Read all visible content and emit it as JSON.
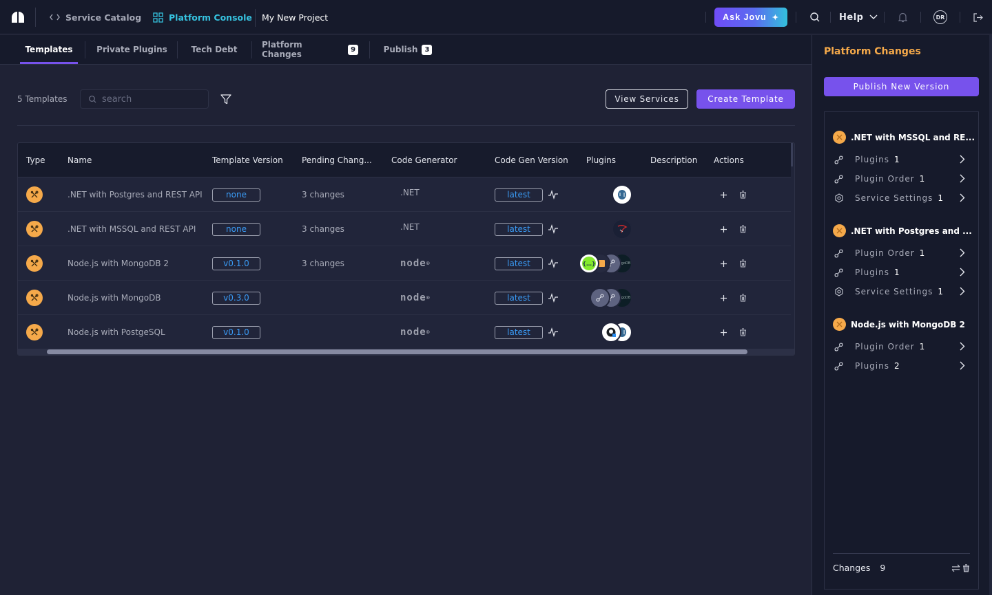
{
  "topbar": {
    "nav": [
      {
        "label": "Service Catalog",
        "icon": "code-brackets-icon",
        "active": false
      },
      {
        "label": "Platform Console",
        "icon": "grid-icon",
        "active": true
      }
    ],
    "project": "My New Project",
    "ask_label": "Ask Jovu",
    "help_label": "Help",
    "avatar_initials": "DR"
  },
  "tabs": [
    {
      "label": "Templates",
      "badge": null,
      "active": true
    },
    {
      "label": "Private Plugins",
      "badge": null
    },
    {
      "label": "Tech Debt",
      "badge": null
    },
    {
      "label": "Platform Changes",
      "badge": "9"
    },
    {
      "label": "Publish",
      "badge": "3"
    }
  ],
  "toolbar": {
    "count_label": "5 Templates",
    "search_placeholder": "search",
    "view_services_label": "View Services",
    "create_template_label": "Create Template"
  },
  "table": {
    "columns": [
      "Type",
      "Name",
      "Template Version",
      "Pending Chang...",
      "Code Generator",
      "Code Gen Version",
      "Plugins",
      "Description",
      "Actions"
    ],
    "rows": [
      {
        "name": ".NET with Postgres and REST API",
        "version": "none",
        "pending": "3 changes",
        "generator": ".NET",
        "gen_version": "latest",
        "plugins": [
          "postgresql"
        ],
        "description": ""
      },
      {
        "name": ".NET with MSSQL and REST API",
        "version": "none",
        "pending": "3 changes",
        "generator": ".NET",
        "gen_version": "latest",
        "plugins": [
          "mssql"
        ],
        "description": ""
      },
      {
        "name": "Node.js with MongoDB 2",
        "version": "v0.1.0",
        "pending": "3 changes",
        "generator": "node",
        "gen_version": "latest",
        "plugins": [
          "swagger",
          "wallet",
          "plugin",
          "mongodb"
        ],
        "description": ""
      },
      {
        "name": "Node.js with MongoDB",
        "version": "v0.3.0",
        "pending": "",
        "generator": "node",
        "gen_version": "latest",
        "plugins": [
          "plugin",
          "plugin",
          "mongodb"
        ],
        "description": ""
      },
      {
        "name": "Node.js with PostgeSQL",
        "version": "v0.1.0",
        "pending": "",
        "generator": "node",
        "gen_version": "latest",
        "plugins": [
          "github",
          "postgresql"
        ],
        "description": ""
      }
    ]
  },
  "panel": {
    "title": "Platform Changes",
    "publish_label": "Publish New Version",
    "groups": [
      {
        "title": ".NET with MSSQL and RE...",
        "items": [
          {
            "label": "Plugins",
            "count": "1",
            "icon": "plugin-icon"
          },
          {
            "label": "Plugin Order",
            "count": "1",
            "icon": "plugin-icon"
          },
          {
            "label": "Service Settings",
            "count": "1",
            "icon": "gear-icon"
          }
        ]
      },
      {
        "title": ".NET with Postgres and ...",
        "items": [
          {
            "label": "Plugin Order",
            "count": "1",
            "icon": "plugin-icon"
          },
          {
            "label": "Plugins",
            "count": "1",
            "icon": "plugin-icon"
          },
          {
            "label": "Service Settings",
            "count": "1",
            "icon": "gear-icon"
          }
        ]
      },
      {
        "title": "Node.js with MongoDB 2",
        "items": [
          {
            "label": "Plugin Order",
            "count": "1",
            "icon": "plugin-icon"
          },
          {
            "label": "Plugins",
            "count": "2",
            "icon": "plugin-icon"
          }
        ]
      }
    ],
    "footer_label": "Changes",
    "footer_count": "9"
  },
  "colors": {
    "accent": "#7752ec",
    "orange": "#f5a94a",
    "link": "#3a9bf5",
    "active_nav": "#36c3e0"
  }
}
